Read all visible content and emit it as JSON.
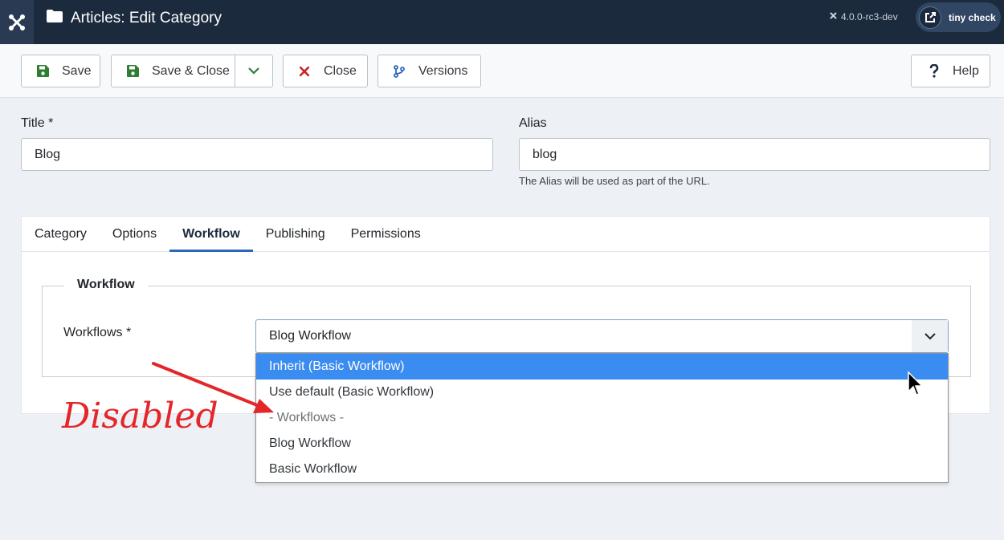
{
  "header": {
    "title": "Articles: Edit Category",
    "version": "4.0.0-rc3-dev",
    "user_name": "tiny check"
  },
  "toolbar": {
    "save": "Save",
    "save_close": "Save & Close",
    "close": "Close",
    "versions": "Versions",
    "help": "Help"
  },
  "form": {
    "title_label": "Title *",
    "title_value": "Blog",
    "alias_label": "Alias",
    "alias_value": "blog",
    "alias_hint": "The Alias will be used as part of the URL."
  },
  "tabs": [
    {
      "label": "Category"
    },
    {
      "label": "Options"
    },
    {
      "label": "Workflow"
    },
    {
      "label": "Publishing"
    },
    {
      "label": "Permissions"
    }
  ],
  "workflow": {
    "legend": "Workflow",
    "field_label": "Workflows *",
    "selected_value": "Blog Workflow",
    "options": [
      {
        "label": "Inherit (Basic Workflow)"
      },
      {
        "label": "Use default (Basic Workflow)"
      },
      {
        "label": "- Workflows -"
      },
      {
        "label": "Blog Workflow"
      },
      {
        "label": "Basic Workflow"
      }
    ]
  },
  "annotation": {
    "text": "Disabled",
    "color": "#e3262a"
  },
  "colors": {
    "header_bg": "#1c2a3e",
    "accent": "#2a69b8",
    "option_highlight": "#3b8cf0",
    "save_green": "#2f7d32",
    "close_red": "#c52827",
    "versions_blue": "#2a69b8"
  },
  "icons": {
    "logo": "joomla-logo-icon",
    "title": "folder-icon",
    "save": "floppy-disk-icon",
    "close": "x-icon",
    "versions": "code-branch-icon",
    "help": "question-icon",
    "dropdown": "chevron-down-icon"
  }
}
